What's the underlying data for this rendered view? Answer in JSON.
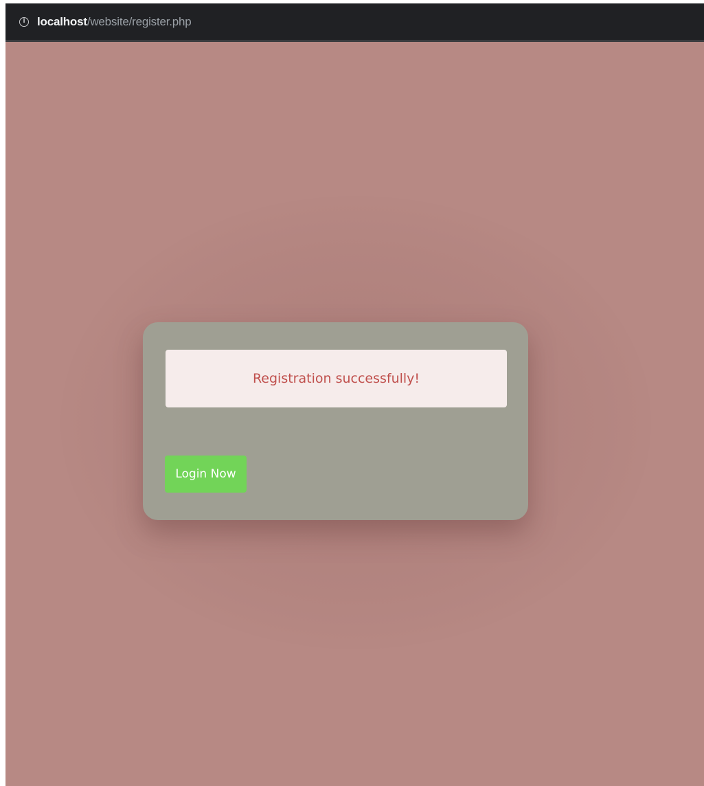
{
  "browser": {
    "url_host": "localhost",
    "url_path": "/website/register.php",
    "info_icon": "info-circle-icon"
  },
  "card": {
    "message": "Registration successfully!",
    "login_button_label": "Login Now"
  },
  "colors": {
    "page_background": "#b78984",
    "card_background": "#9f9f93",
    "message_background": "#f6eceb",
    "message_text": "#c0504d",
    "button_background": "#72d458"
  }
}
